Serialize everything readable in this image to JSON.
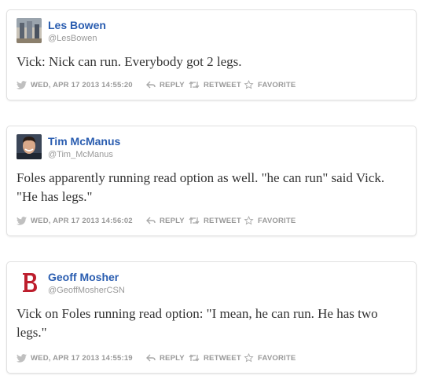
{
  "tweets": [
    {
      "name": "Les Bowen",
      "handle": "@LesBowen",
      "text": "Vick: Nick can run. Everybody got 2 legs.",
      "datetime": "WED, APR 17 2013 14:55:20",
      "reply_label": "REPLY",
      "retweet_label": "RETWEET",
      "favorite_label": "FAVORITE",
      "avatar": "profile-photo"
    },
    {
      "name": "Tim McManus",
      "handle": "@Tim_McManus",
      "text": "Foles apparently running read option as well. \"he can run\" said Vick. \"He has legs.\"",
      "datetime": "WED, APR 17 2013 14:56:02",
      "reply_label": "REPLY",
      "retweet_label": "RETWEET",
      "favorite_label": "FAVORITE",
      "avatar": "profile-photo"
    },
    {
      "name": "Geoff Mosher",
      "handle": "@GeoffMosherCSN",
      "text": "Vick on Foles running read option: \"I mean, he can run. He has two legs.\"",
      "datetime": "WED, APR 17 2013 14:55:19",
      "reply_label": "REPLY",
      "retweet_label": "RETWEET",
      "favorite_label": "FAVORITE",
      "avatar": "red-sox-b-logo"
    }
  ],
  "colors": {
    "name": "#2a5db0",
    "meta": "#999999",
    "text": "#333333",
    "border": "#e1e1e1",
    "red_sox": "#bd1e2d"
  },
  "icons": {
    "bird": "twitter-bird-icon",
    "reply": "reply-arrow-icon",
    "retweet": "retweet-icon",
    "favorite": "star-outline-icon"
  }
}
